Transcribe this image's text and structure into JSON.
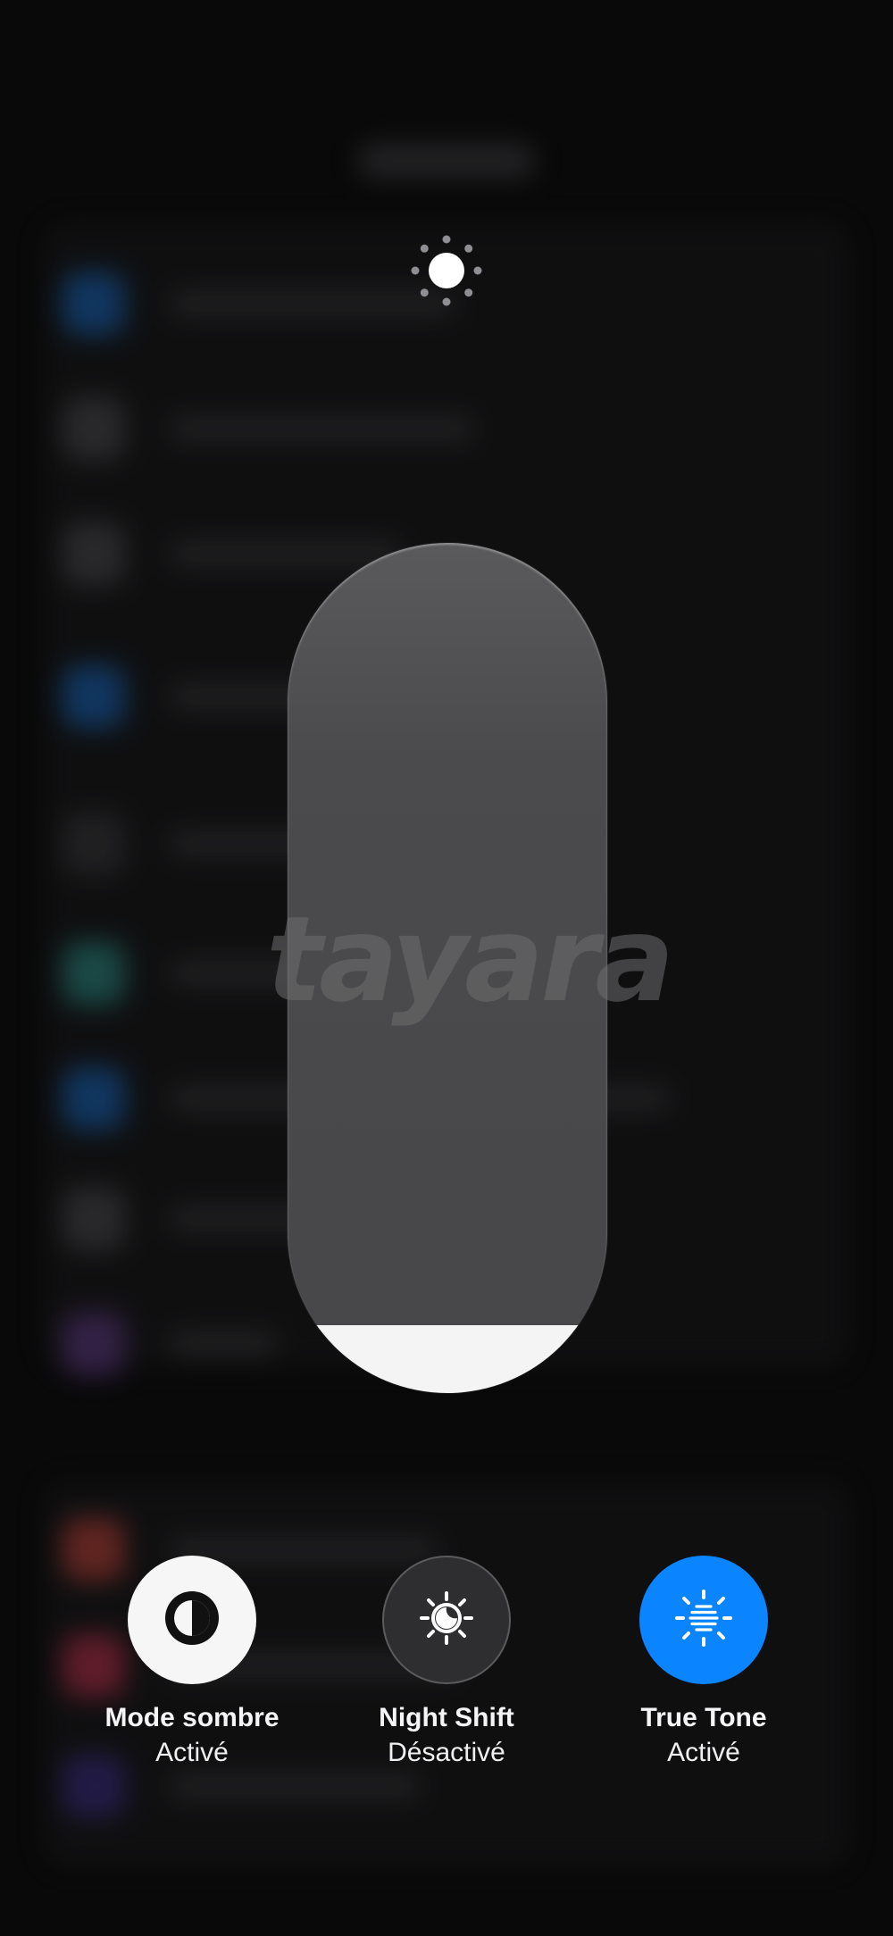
{
  "watermark": "tayara",
  "brightness": {
    "level": 0.08,
    "icon": "sun-icon"
  },
  "controls": [
    {
      "name": "dark-mode",
      "label": "Mode sombre",
      "state": "Activé",
      "icon": "half-circle-icon"
    },
    {
      "name": "night-shift",
      "label": "Night Shift",
      "state": "Désactivé",
      "icon": "sun-moon-icon"
    },
    {
      "name": "true-tone",
      "label": "True Tone",
      "state": "Activé",
      "icon": "true-tone-icon"
    }
  ],
  "colors": {
    "accent": "#0a84ff",
    "slider_fill": "#f4f4f5",
    "slider_track": "#4b4b4d"
  }
}
